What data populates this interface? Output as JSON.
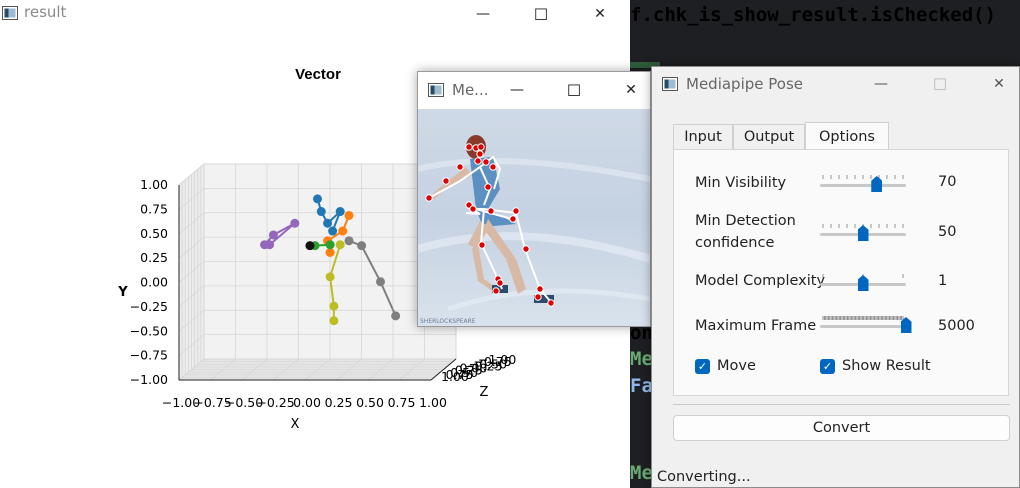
{
  "editor": {
    "lines": [
      {
        "text": "f.chk_is_show_result.isChecked()",
        "color": "#e6e6e6"
      },
      {
        "text": "on",
        "color": "#e6e6e6"
      },
      {
        "text": "Me",
        "color": "#6aab73"
      },
      {
        "text": "Fa",
        "color": "#8fb7e8"
      },
      {
        "text": "Me",
        "color": "#6aab73"
      }
    ]
  },
  "result_window": {
    "title": "result",
    "controls": {
      "minimize": "—",
      "maximize": "☐",
      "close": "✕"
    }
  },
  "chart_data": {
    "type": "scatter",
    "projection": "3d",
    "title": "Vector",
    "xlabel": "X",
    "ylabel": "Y",
    "zlabel": "Z",
    "xlim": [
      -1.0,
      1.0
    ],
    "ylim": [
      -1.0,
      1.0
    ],
    "zlim": [
      -1.0,
      1.0
    ],
    "x_ticks": [
      "−1.00",
      "−0.75",
      "−0.50",
      "−0.25",
      "0.00",
      "0.25",
      "0.50",
      "0.75",
      "1.00"
    ],
    "y_ticks": [
      "1.00",
      "0.75",
      "0.50",
      "0.25",
      "0.00",
      "−0.25",
      "−0.50",
      "−0.75",
      "−1.00"
    ],
    "z_ticks": [
      "−1.00",
      "−0.75",
      "−0.50",
      "−0.25",
      "0.00",
      "0.25",
      "0.50",
      "0.75",
      "1.00"
    ],
    "grid": true,
    "series": [
      {
        "color": "#1f77b4",
        "points": [
          [
            0.0,
            0.75
          ],
          [
            0.03,
            0.62
          ],
          [
            0.08,
            0.5
          ],
          [
            0.18,
            0.62
          ],
          [
            0.12,
            0.42
          ]
        ]
      },
      {
        "color": "#9467bd",
        "points": [
          [
            -0.42,
            0.28
          ],
          [
            -0.35,
            0.38
          ],
          [
            -0.18,
            0.5
          ],
          [
            -0.38,
            0.28
          ]
        ]
      },
      {
        "color": "#ff7f0e",
        "points": [
          [
            0.25,
            0.58
          ],
          [
            0.2,
            0.42
          ],
          [
            0.08,
            0.32
          ],
          [
            0.1,
            0.2
          ]
        ]
      },
      {
        "color": "#2ca02c",
        "points": [
          [
            -0.02,
            0.27
          ],
          [
            0.1,
            0.28
          ]
        ]
      },
      {
        "color": "#7f7f7f",
        "points": [
          [
            0.25,
            0.32
          ],
          [
            0.35,
            0.27
          ],
          [
            0.5,
            -0.1
          ],
          [
            0.62,
            -0.45
          ]
        ]
      },
      {
        "color": "#bcbd22",
        "points": [
          [
            0.18,
            0.28
          ],
          [
            0.1,
            -0.05
          ],
          [
            0.13,
            -0.35
          ],
          [
            0.13,
            -0.5
          ]
        ]
      },
      {
        "color": "#111111",
        "points": [
          [
            -0.06,
            0.27
          ]
        ]
      }
    ]
  },
  "preview_window": {
    "title": "Me...",
    "watermark": "SHERLOCKSPEARE",
    "controls": {
      "minimize": "—",
      "maximize": "☐",
      "close": "✕"
    }
  },
  "pose_window": {
    "title": "Mediapipe Pose",
    "controls": {
      "minimize": "—",
      "maximize": "☐",
      "close": "✕"
    },
    "tabs": [
      {
        "label": "Input"
      },
      {
        "label": "Output"
      },
      {
        "label": "Options",
        "active": true
      }
    ],
    "options": {
      "min_visibility": {
        "label": "Min Visibility",
        "value": "70",
        "fraction": 0.66
      },
      "min_detection": {
        "label_line1": "Min Detection",
        "label_line2": "confidence",
        "value": "50",
        "fraction": 0.5
      },
      "model_complexity": {
        "label": "Model Complexity",
        "value": "1",
        "fraction": 0.5
      },
      "max_frame": {
        "label": "Maximum Frame",
        "value": "5000",
        "fraction": 1.0
      }
    },
    "move_checkbox": {
      "label": "Move",
      "checked": true
    },
    "show_result_checkbox": {
      "label": "Show Result",
      "checked": true
    },
    "convert_button": "Convert",
    "status": "Converting..."
  }
}
